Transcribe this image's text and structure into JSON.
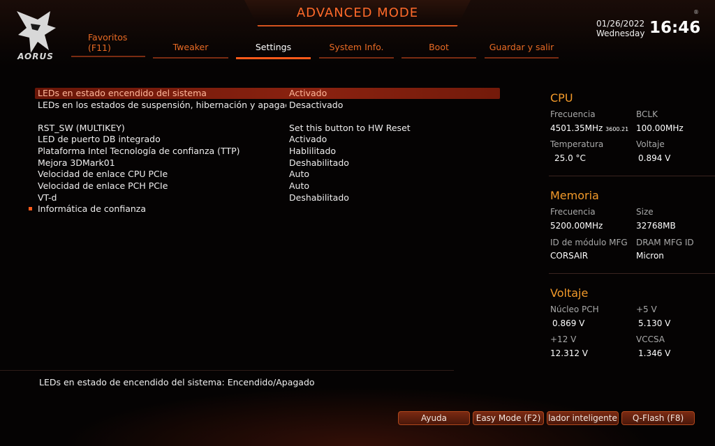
{
  "header": {
    "mode_title": "ADVANCED MODE",
    "logo_text": "AORUS",
    "date": "01/26/2022",
    "day": "Wednesday",
    "time": "16:46",
    "reg_mark": "®"
  },
  "tabs": [
    {
      "label": "Favoritos",
      "sub": "(F11)"
    },
    {
      "label": "Tweaker"
    },
    {
      "label": "Settings",
      "active": true
    },
    {
      "label": "System Info."
    },
    {
      "label": "Boot"
    },
    {
      "label": "Guardar y salir"
    }
  ],
  "settings": [
    {
      "label": "LEDs en estado encendido del sistema",
      "value": "Activado"
    },
    {
      "label": "LEDs en los estados de suspensión, hibernación y apagado",
      "value": "Desactivado"
    },
    {
      "label": "RST_SW (MULTIKEY)",
      "value": "Set this button to HW Reset"
    },
    {
      "label": "LED de puerto DB integrado",
      "value": "Activado"
    },
    {
      "label": "Plataforma Intel Tecnología de confianza (TTP)",
      "value": "Hablilitado"
    },
    {
      "label": "Mejora 3DMark01",
      "value": "Deshabilitado"
    },
    {
      "label": "Velocidad de enlace CPU PCIe",
      "value": "Auto"
    },
    {
      "label": "Velocidad de enlace PCH PCIe",
      "value": "Auto"
    },
    {
      "label": "VT-d",
      "value": "Deshabilitado"
    },
    {
      "label": "Informática de confianza",
      "value": ""
    }
  ],
  "panel": {
    "cpu": {
      "title": "CPU",
      "freq_label": "Frecuencia",
      "freq_value": "4501.35MHz",
      "freq_sub": "3600.21",
      "bclk_label": "BCLK",
      "bclk_value": "100.00MHz",
      "temp_label": "Temperatura",
      "temp_value": "25.0 °C",
      "volt_label": "Voltaje",
      "volt_value": "0.894 V"
    },
    "memory": {
      "title": "Memoria",
      "freq_label": "Frecuencia",
      "freq_value": "5200.00MHz",
      "size_label": "Size",
      "size_value": "32768MB",
      "id_label": "ID de módulo MFG",
      "id_value": "CORSAIR",
      "dram_label": "DRAM MFG ID",
      "dram_value": "Micron"
    },
    "voltage": {
      "title": "Voltaje",
      "pch_label": "Núcleo PCH",
      "pch_value": "0.869 V",
      "v5_label": "+5 V",
      "v5_value": "5.130 V",
      "v12_label": "+12 V",
      "v12_value": "12.312 V",
      "vccsa_label": "VCCSA",
      "vccsa_value": "1.346 V"
    }
  },
  "help_text": "LEDs en estado de encendido del sistema: Encendido/Apagado",
  "footer": {
    "help": "Ayuda",
    "easy_mode": "Easy Mode (F2)",
    "smart_fan": "lador inteligente",
    "qflash": "Q-Flash (F8)"
  },
  "colors": {
    "accent": "#ff5a1a",
    "selected_row": "#8a2210",
    "panel_heading": "#f39a2a"
  }
}
